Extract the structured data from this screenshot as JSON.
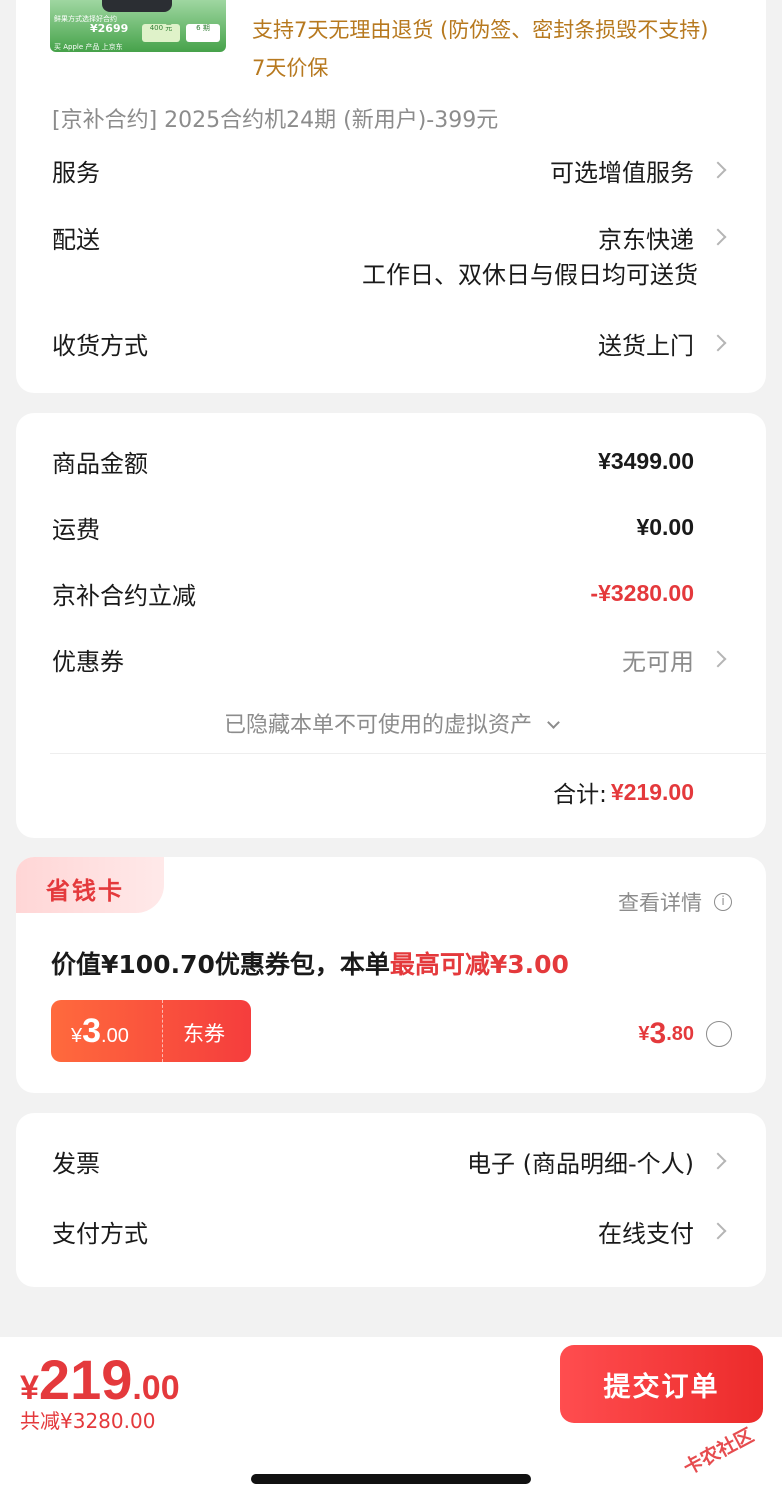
{
  "product": {
    "thumb_text_top": "鲜果方式选择好合约",
    "thumb_price": "¥2699",
    "thumb_pill_1": "400 元",
    "thumb_pill_2": "6 期",
    "thumb_bottom": "买 Apple 产品 上京东",
    "return_policy": "支持7天无理由退货 (防伪签、密封条损毁不支持)",
    "price_protect": "7天价保",
    "contract": "[京补合约]  2025合约机24期 (新用户)-399元"
  },
  "service": {
    "label": "服务",
    "value": "可选增值服务"
  },
  "delivery": {
    "label": "配送",
    "value": "京东快递",
    "note": "工作日、双休日与假日均可送货"
  },
  "receive": {
    "label": "收货方式",
    "value": "送货上门"
  },
  "amounts": {
    "goods_label": "商品金额",
    "goods_value": "¥3499.00",
    "freight_label": "运费",
    "freight_value": "¥0.00",
    "discount_label": "京补合约立减",
    "discount_value": "-¥3280.00",
    "coupon_label": "优惠券",
    "coupon_value": "无可用",
    "hidden_assets": "已隐藏本单不可使用的虚拟资产",
    "total_label": "合计:",
    "total_value": "¥219.00"
  },
  "saving_card": {
    "tag": "省钱卡",
    "details": "查看详情",
    "info_glyph": "i",
    "desc_prefix": "价值¥100.70优惠券包，本单",
    "desc_highlight": "最高可减¥3.00",
    "coupon_sym": "¥",
    "coupon_int": "3",
    "coupon_dec": ".00",
    "coupon_type": "东券",
    "price_sym": "¥",
    "price_int": "3",
    "price_dec": ".80"
  },
  "invoice": {
    "label": "发票",
    "value": "电子 (商品明细-个人)"
  },
  "payment": {
    "label": "支付方式",
    "value": "在线支付"
  },
  "bottom": {
    "price_sym": "¥",
    "price_int": "219",
    "price_dec": ".00",
    "total_off": "共减¥3280.00",
    "submit": "提交订单",
    "watermark": "卡农社区"
  },
  "colors": {
    "accent": "#e4393c",
    "promise": "#b7791f",
    "background": "#f2f2f2"
  }
}
